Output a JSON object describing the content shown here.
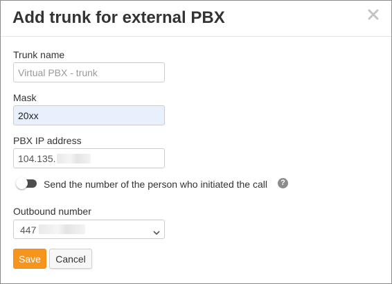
{
  "dialog": {
    "title": "Add trunk for external PBX"
  },
  "form": {
    "trunk_name": {
      "label": "Trunk name",
      "value": "",
      "placeholder": "Virtual PBX - trunk"
    },
    "mask": {
      "label": "Mask",
      "value": "20xx"
    },
    "pbx_ip": {
      "label": "PBX IP address",
      "value": "104.135."
    },
    "send_caller_number": {
      "label": "Send the number of the person who initiated the call",
      "enabled": false,
      "help_icon": "question-icon"
    },
    "outbound_number": {
      "label": "Outbound number",
      "selected": "447"
    }
  },
  "buttons": {
    "save_label": "Save",
    "cancel_label": "Cancel"
  },
  "colors": {
    "accent": "#f7941d",
    "autofill_bg": "#e8f0fe",
    "toggle_track": "#4d4d4d"
  }
}
